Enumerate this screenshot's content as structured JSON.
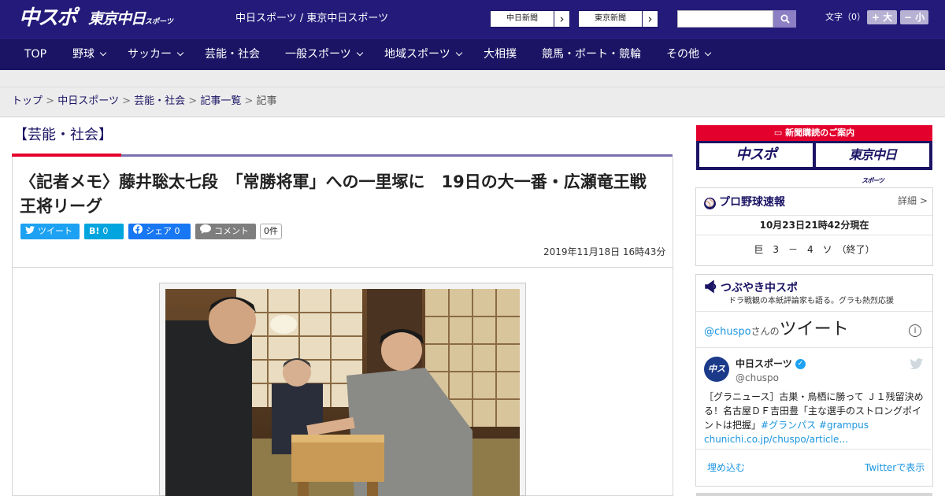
{
  "header": {
    "logo_primary": "中スポ",
    "logo_secondary": "東京中日",
    "logo_secondary_suffix": "スポーツ",
    "site_links": "中日スポーツ / 東京中日スポーツ",
    "paper_links": [
      "中日新聞",
      "東京新聞"
    ],
    "search_placeholder": "",
    "font_size_label": "文字（0）",
    "font_larger": "+ 大",
    "font_smaller": "− 小",
    "colors": {
      "primary": "#231a7a",
      "nav": "#1b1464",
      "accent": "#e3002d"
    }
  },
  "nav": {
    "items": [
      {
        "label": "TOP",
        "dropdown": false
      },
      {
        "label": "野球",
        "dropdown": true
      },
      {
        "label": "サッカー",
        "dropdown": true
      },
      {
        "label": "芸能・社会",
        "dropdown": false
      },
      {
        "label": "一般スポーツ",
        "dropdown": true
      },
      {
        "label": "地域スポーツ",
        "dropdown": true
      },
      {
        "label": "大相撲",
        "dropdown": false
      },
      {
        "label": "競馬・ボート・競輪",
        "dropdown": false
      },
      {
        "label": "その他",
        "dropdown": true
      }
    ]
  },
  "breadcrumb": {
    "items": [
      "トップ",
      "中日スポーツ",
      "芸能・社会",
      "記事一覧"
    ],
    "current": "記事",
    "separator": ">"
  },
  "article": {
    "section": "【芸能・社会】",
    "headline": "〈記者メモ〉藤井聡太七段　「常勝将軍」への一里塚に　19日の大一番・広瀬竜王戦　王将リーグ",
    "share": {
      "tweet": "ツイート",
      "hatena_icon": "B!",
      "hatena_count": "0",
      "facebook": "シェア",
      "facebook_count": "0",
      "comment": "コメント",
      "comment_count": "0件"
    },
    "date": "2019年11月18日 16時43分"
  },
  "sidebar": {
    "subscribe": {
      "title": "新聞購読のご案内",
      "tiles": [
        "中スポ",
        "東京中日"
      ],
      "tile_suffix": "スポーツ"
    },
    "baseball": {
      "title": "プロ野球速報",
      "detail": "詳細 >",
      "time": "10月23日21時42分現在",
      "score": "巨　3　－　4　ソ　（終了）"
    },
    "tweets": {
      "title": "つぶやき中スポ",
      "subtitle": "ドラ戦観の本紙評論家も語る。グラも熱烈応援",
      "widget_handle": "@chuspo",
      "widget_san": "さんの",
      "widget_label": "ツイート",
      "info": "i",
      "account_name": "中日スポーツ",
      "account_handle": "@chuspo",
      "avatar_text": "中スポ",
      "tweet_text": "［グラニュース］古巣・鳥栖に勝って Ｊ１残留決める！名古屋ＤＦ吉田豊「主な選手のストロングポイントは把握」",
      "tags": [
        "#グランパス",
        "#grampus"
      ],
      "link": "chunichi.co.jp/chuspo/article…",
      "embed": "埋め込む",
      "view_on_twitter": "Twitterで表示"
    }
  }
}
